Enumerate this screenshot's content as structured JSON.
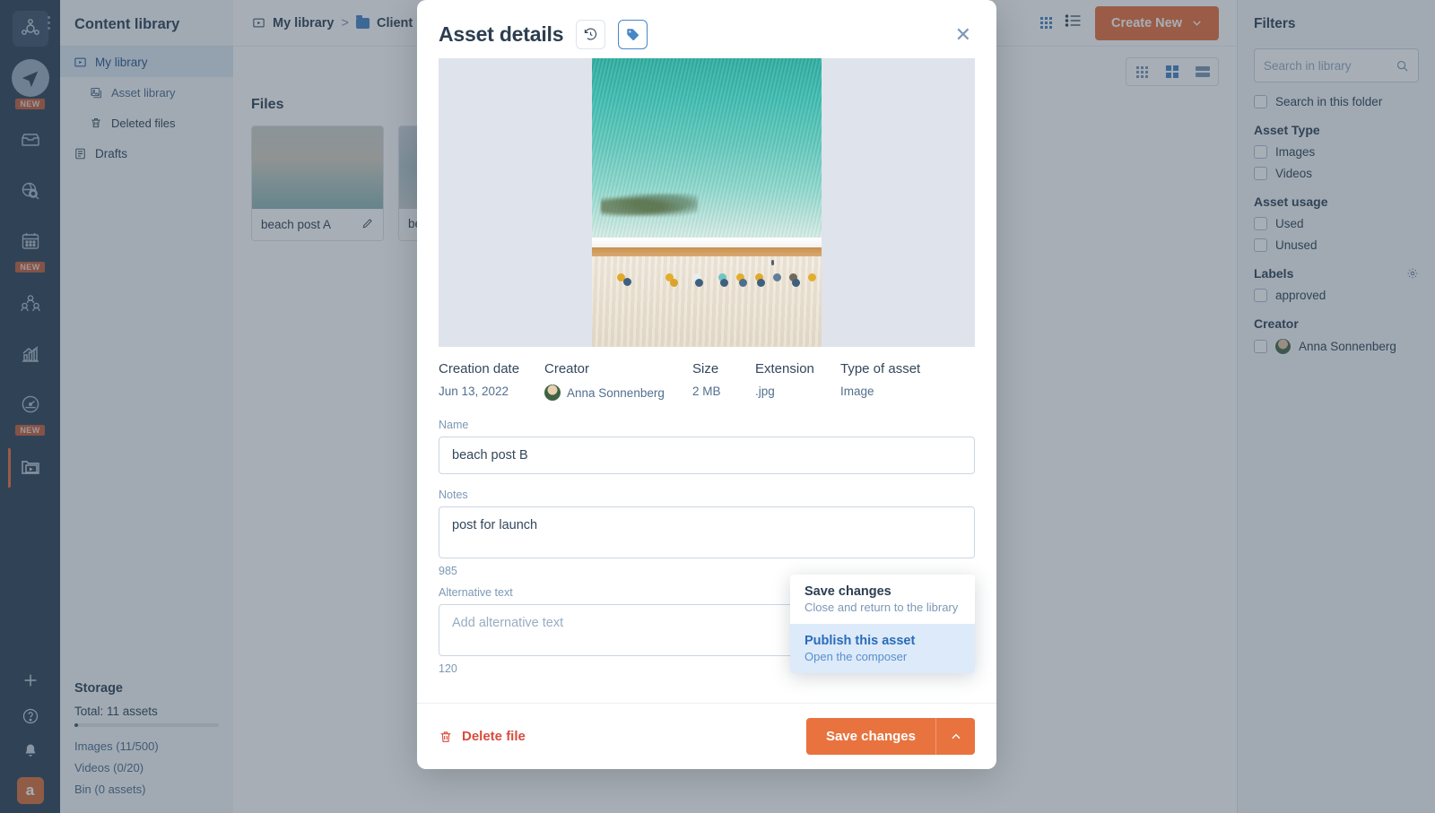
{
  "rail": {
    "logo_icon": "sprocket-logo-icon",
    "items": [
      {
        "icon": "paper-plane-icon",
        "badge": "NEW"
      },
      {
        "icon": "inbox-icon",
        "badge": ""
      },
      {
        "icon": "globe-search-icon",
        "badge": ""
      },
      {
        "icon": "calendar-icon",
        "badge": "NEW"
      },
      {
        "icon": "contacts-icon",
        "badge": ""
      },
      {
        "icon": "bar-chart-icon",
        "badge": ""
      },
      {
        "icon": "speedometer-icon",
        "badge": "NEW"
      },
      {
        "icon": "media-folder-icon",
        "badge": ""
      }
    ],
    "bottom": [
      {
        "icon": "plus-icon"
      },
      {
        "icon": "help-circle-icon"
      },
      {
        "icon": "bell-icon"
      }
    ],
    "avatar_letter": "a"
  },
  "sidebar": {
    "title": "Content library",
    "items": [
      {
        "label": "My library",
        "icon": "media-library-icon"
      },
      {
        "label": "Asset library",
        "icon": "images-icon"
      },
      {
        "label": "Deleted files",
        "icon": "trash-icon"
      },
      {
        "label": "Drafts",
        "icon": "drafts-icon"
      }
    ],
    "storage": {
      "heading": "Storage",
      "total": "Total: 11 assets",
      "lines": [
        "Images (11/500)",
        "Videos (0/20)",
        "Bin (0 assets)"
      ]
    }
  },
  "topbar": {
    "breadcrumb": [
      {
        "label": "My library",
        "icon": "media-library-icon"
      },
      {
        "label": "Client",
        "icon": "folder-icon"
      }
    ],
    "separator": ">",
    "grid_icon": "grid-icon",
    "list_icon": "list-icon",
    "create_label": "Create New",
    "create_caret": "chevron-down-icon",
    "create_color": "#e8733f"
  },
  "viewtoggle": {
    "options": [
      "small-grid-view",
      "medium-grid-view",
      "list-view"
    ],
    "selected": "medium-grid-view",
    "active_color": "#4787c7"
  },
  "files": {
    "heading": "Files",
    "tiles": [
      {
        "name": "beach post A",
        "edit_icon": "pencil-icon"
      },
      {
        "name": "be",
        "edit_icon": "pencil-icon"
      }
    ]
  },
  "filters": {
    "title": "Filters",
    "search_placeholder": "Search in library",
    "search_icon": "search-icon",
    "search_folder": "Search in this folder",
    "groups": [
      {
        "heading": "Asset Type",
        "options": [
          "Images",
          "Videos"
        ]
      },
      {
        "heading": "Asset usage",
        "options": [
          "Used",
          "Unused"
        ]
      },
      {
        "heading": "Labels",
        "options": [
          "approved"
        ],
        "gear_icon": "gear-icon"
      },
      {
        "heading": "Creator",
        "options": [
          "Anna Sonnenberg"
        ],
        "avatar": true
      }
    ]
  },
  "modal": {
    "title": "Asset details",
    "history_icon": "clock-rewind-icon",
    "tag_icon": "tag-icon",
    "close_icon": "close-icon",
    "preview_alt": "aerial-beach-photo",
    "meta": [
      {
        "key": "Creation date",
        "value": "Jun 13, 2022"
      },
      {
        "key": "Creator",
        "value": "Anna Sonnenberg",
        "avatar": true
      },
      {
        "key": "Size",
        "value": "2 MB"
      },
      {
        "key": "Extension",
        "value": ".jpg"
      },
      {
        "key": "Type of asset",
        "value": "Image"
      }
    ],
    "fields": {
      "name_label": "Name",
      "name_value": "beach post B",
      "notes_label": "Notes",
      "notes_value": "post for launch",
      "notes_count": "985",
      "alt_label": "Alternative text",
      "alt_placeholder": "Add alternative text",
      "alt_value": "",
      "alt_count": "120"
    },
    "footer": {
      "delete_label": "Delete file",
      "delete_icon": "trash-icon",
      "delete_color": "#d94c3d",
      "save_label": "Save changes",
      "save_caret_icon": "chevron-up-icon",
      "save_color": "#e8733f"
    },
    "dropdown": [
      {
        "title": "Save changes",
        "subtitle": "Close and return to the library",
        "highlighted": false
      },
      {
        "title": "Publish this asset",
        "subtitle": "Open the composer",
        "highlighted": true
      }
    ]
  }
}
